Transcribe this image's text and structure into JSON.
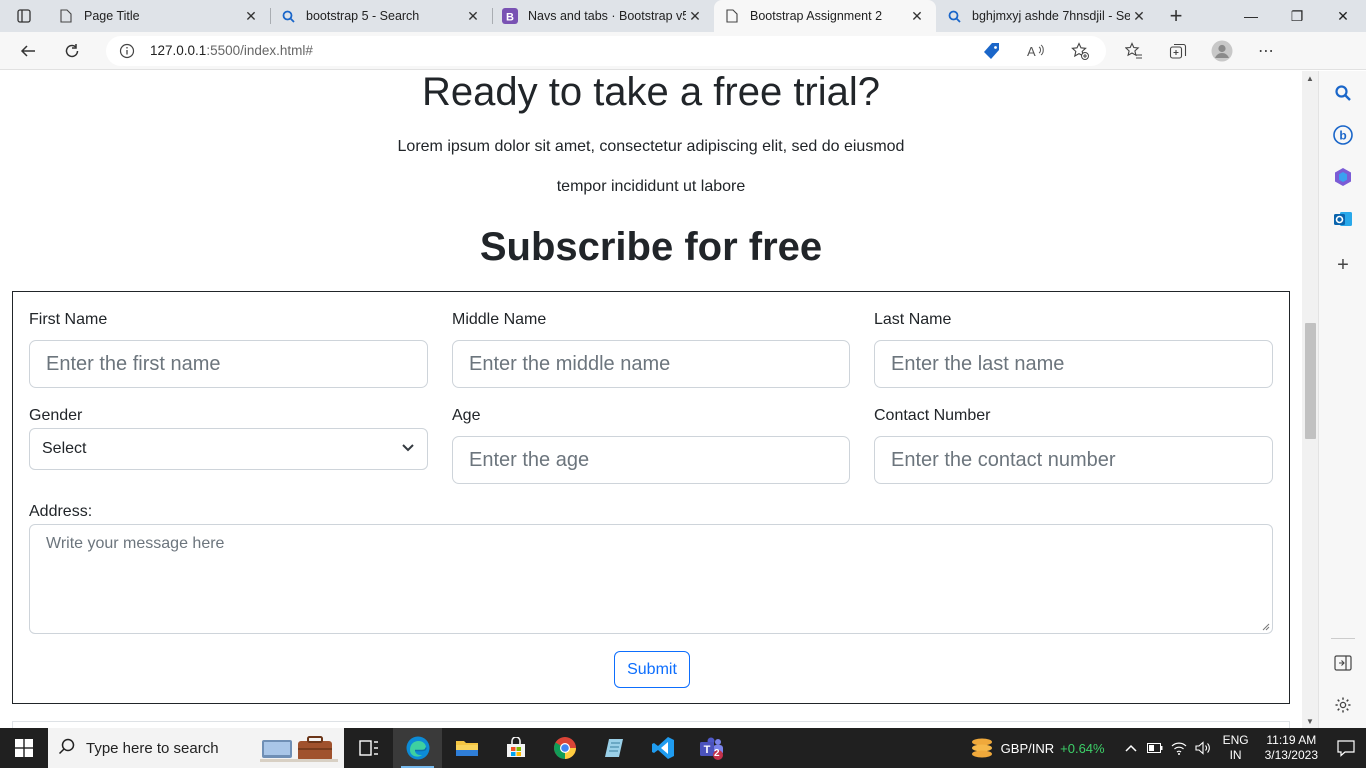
{
  "browser": {
    "tabs": [
      {
        "title": "Page Title",
        "icon": "page-icon",
        "active": false
      },
      {
        "title": "bootstrap 5 - Search",
        "icon": "search-icon",
        "active": false
      },
      {
        "title": "Navs and tabs · Bootstrap v5.",
        "icon": "bootstrap-icon",
        "active": false
      },
      {
        "title": "Bootstrap Assignment 2",
        "icon": "page-icon",
        "active": true
      },
      {
        "title": "bghjmxyj ashde 7hnsdjil - Sea",
        "icon": "search-icon",
        "active": false
      }
    ],
    "url_host": "127.0.0.1",
    "url_rest": ":5500/index.html#"
  },
  "page": {
    "hero_title": "Ready to take a free trial?",
    "hero_text_line1": "Lorem ipsum dolor sit amet, consectetur adipiscing elit, sed do eiusmod",
    "hero_text_line2": "tempor incididunt ut labore",
    "subscribe_title": "Subscribe for free",
    "form": {
      "first_name_label": "First Name",
      "first_name_placeholder": "Enter the first name",
      "middle_name_label": "Middle Name",
      "middle_name_placeholder": "Enter the middle name",
      "last_name_label": "Last Name",
      "last_name_placeholder": "Enter the last name",
      "gender_label": "Gender",
      "gender_value": "Select",
      "age_label": "Age",
      "age_placeholder": "Enter the age",
      "contact_label": "Contact Number",
      "contact_placeholder": "Enter the contact number",
      "address_label": "Address:",
      "address_placeholder": "Write your message here",
      "submit_label": "Submit"
    }
  },
  "taskbar": {
    "search_placeholder": "Type here to search",
    "stock_name": "GBP/INR",
    "stock_change": "+0.64%",
    "lang_line1": "ENG",
    "lang_line2": "IN",
    "time": "11:19 AM",
    "date": "3/13/2023",
    "teams_badge": "2"
  },
  "colors": {
    "accent": "#0d6efd",
    "stock_positive": "#3dd068"
  }
}
